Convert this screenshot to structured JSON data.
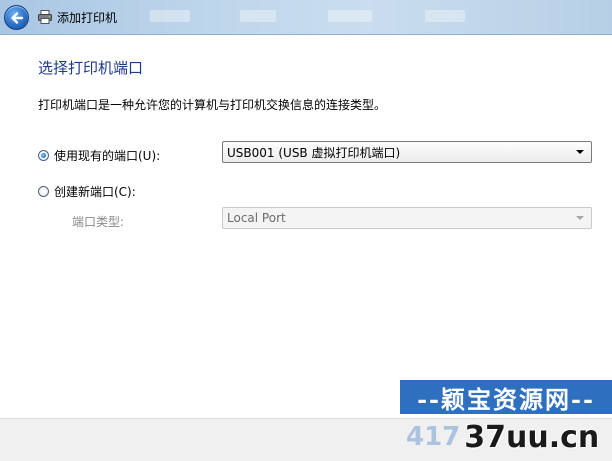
{
  "window": {
    "title": "添加打印机",
    "icons": {
      "back": "back-arrow-icon",
      "printer": "printer-icon"
    }
  },
  "page": {
    "heading": "选择打印机端口",
    "description": "打印机端口是一种允许您的计算机与打印机交换信息的连接类型。"
  },
  "options": {
    "use_existing": {
      "label": "使用现有的端口(U):",
      "checked": true,
      "value": "USB001 (USB 虚拟打印机端口)"
    },
    "create_new": {
      "label": "创建新端口(C):",
      "checked": false,
      "port_type_label": "端口类型:",
      "port_type_value": "Local Port"
    }
  },
  "watermark": {
    "top_text": "--颖宝资源网--",
    "bottom_faded": "417",
    "bottom_strong": "37uu.cn"
  },
  "colors": {
    "heading": "#1e3a8a",
    "title_bar": "#bcd4ea",
    "watermark_blue": "#2f6fc0"
  }
}
